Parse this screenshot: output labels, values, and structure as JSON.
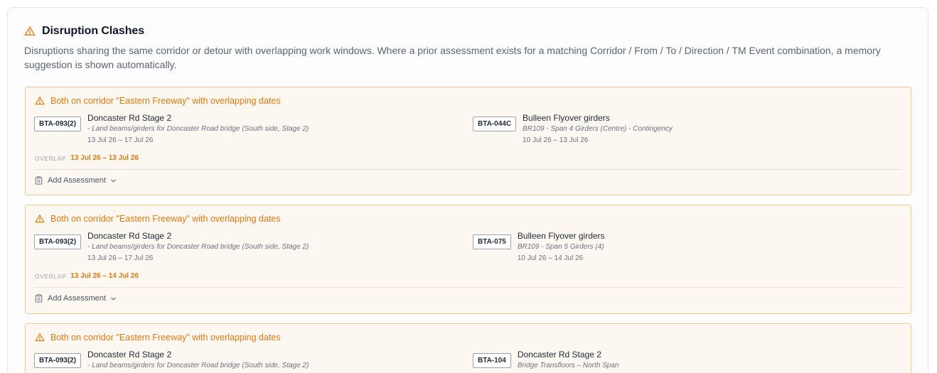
{
  "page": {
    "icon": "warning-triangle-icon",
    "title": "Disruption Clashes",
    "description": "Disruptions sharing the same corridor or detour with overlapping work windows. Where a prior assessment exists for a matching Corridor / From / To / Direction / TM Event combination, a memory suggestion is shown automatically."
  },
  "colors": {
    "accent": "#d97a12",
    "card_bg": "#fdf7f1",
    "card_border": "#f0c992"
  },
  "clashes": [
    {
      "title": "Both on corridor \"Eastern Freeway\" with overlapping dates",
      "left": {
        "id": "BTA-093(2)",
        "name": "Doncaster Rd Stage 2",
        "detail": "- Land beams/girders for Doncaster Road bridge (South side, Stage 2)",
        "dates": "13 Jul 26 – 17 Jul 26"
      },
      "right": {
        "id": "BTA-044C",
        "name": "Bulleen Flyover girders",
        "detail": "BR109 - Span 4 Girders (Centre) - Contingency",
        "dates": "10 Jul 26 – 13 Jul 26"
      },
      "overlap_label": "OVERLAP",
      "overlap_value": "13 Jul 26 – 13 Jul 26",
      "assessment_label": "Add Assessment"
    },
    {
      "title": "Both on corridor \"Eastern Freeway\" with overlapping dates",
      "left": {
        "id": "BTA-093(2)",
        "name": "Doncaster Rd Stage 2",
        "detail": "- Land beams/girders for Doncaster Road bridge (South side, Stage 2)",
        "dates": "13 Jul 26 – 17 Jul 26"
      },
      "right": {
        "id": "BTA-075",
        "name": "Bulleen Flyover girders",
        "detail": "BR109 - Span 5 Girders (4)",
        "dates": "10 Jul 26 – 14 Jul 26"
      },
      "overlap_label": "OVERLAP",
      "overlap_value": "13 Jul 26 – 14 Jul 26",
      "assessment_label": "Add Assessment"
    },
    {
      "title": "Both on corridor \"Eastern Freeway\" with overlapping dates",
      "left": {
        "id": "BTA-093(2)",
        "name": "Doncaster Rd Stage 2",
        "detail": "- Land beams/girders for Doncaster Road bridge (South side, Stage 2)",
        "dates": ""
      },
      "right": {
        "id": "BTA-104",
        "name": "Doncaster Rd Stage 2",
        "detail": "Bridge Transfloors – North Span",
        "dates": ""
      }
    }
  ]
}
